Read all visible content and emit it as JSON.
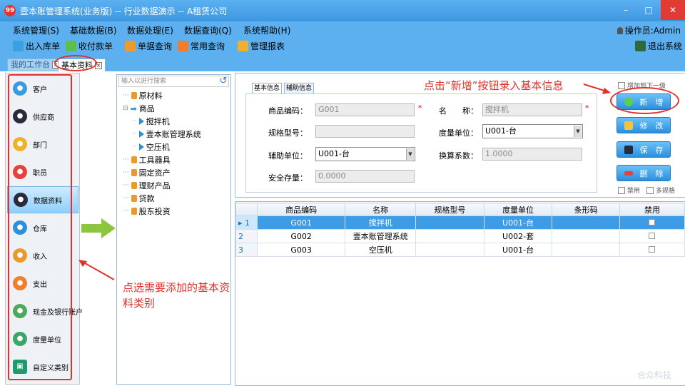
{
  "window": {
    "logo": "99",
    "title": "壹本账管理系统(业务版) -- 行业数据演示 -- A租赁公司",
    "min": "–",
    "max": "□",
    "close": "✕"
  },
  "menubar": {
    "items": [
      "系统管理(S)",
      "基础数据(B)",
      "数据处理(E)",
      "数据查询(Q)",
      "系统帮助(H)"
    ],
    "operator": "操作员:Admin"
  },
  "toolbar": {
    "items": [
      "出入库单",
      "收付款单",
      "单据查询",
      "常用查询",
      "管理报表"
    ],
    "exit": "退出系统"
  },
  "doc_tabs": {
    "workbench": "我的工作台",
    "basic": "基本资料",
    "close_glyph": "×"
  },
  "nav": {
    "items": [
      "客户",
      "供应商",
      "部门",
      "职员",
      "数据资料",
      "仓库",
      "收入",
      "支出",
      "现金及银行账户",
      "度量单位",
      "自定义类别"
    ],
    "active": "数据资料"
  },
  "tree": {
    "search_placeholder": "输入以进行搜索",
    "refresh_glyph": "↺",
    "items": [
      {
        "label": "原材料",
        "level": 0,
        "kind": "leaf"
      },
      {
        "label": "商品",
        "level": 0,
        "kind": "open"
      },
      {
        "label": "搅拌机",
        "level": 1,
        "kind": "child"
      },
      {
        "label": "壹本账管理系统",
        "level": 1,
        "kind": "child"
      },
      {
        "label": "空压机",
        "level": 1,
        "kind": "child"
      },
      {
        "label": "工具器具",
        "level": 0,
        "kind": "leaf"
      },
      {
        "label": "固定资产",
        "level": 0,
        "kind": "leaf"
      },
      {
        "label": "理财产品",
        "level": 0,
        "kind": "leaf"
      },
      {
        "label": "贷款",
        "level": 0,
        "kind": "leaf"
      },
      {
        "label": "股东投资",
        "level": 0,
        "kind": "leaf"
      }
    ]
  },
  "form": {
    "tabs": [
      "基本信息",
      "辅助信息"
    ],
    "code_label": "商品编码：",
    "code_value": "G001",
    "name_label": "名　　称：",
    "name_value": "搅拌机",
    "spec_label": "规格型号：",
    "spec_value": "",
    "unit_label": "度量单位：",
    "unit_value": "U001-台",
    "aux_unit_label": "辅助单位：",
    "aux_unit_value": "U001-台",
    "ratio_label": "换算系数：",
    "ratio_value": "1.0000",
    "safety_label": "安全存量：",
    "safety_value": "0.0000",
    "required_mark": "*"
  },
  "actions": {
    "add_child": "增加到下一级",
    "add": "新　增",
    "edit": "修　改",
    "save": "保　存",
    "delete": "删　除",
    "disabled": "禁用",
    "multi_spec": "多规格"
  },
  "grid": {
    "columns": [
      "商品编码",
      "名称",
      "规格型号",
      "度量单位",
      "条形码",
      "禁用"
    ],
    "rows": [
      {
        "idx": "1",
        "code": "G001",
        "name": "搅拌机",
        "spec": "",
        "unit": "U001-台",
        "barcode": ""
      },
      {
        "idx": "2",
        "code": "G002",
        "name": "壹本账管理系统",
        "spec": "",
        "unit": "U002-套",
        "barcode": ""
      },
      {
        "idx": "3",
        "code": "G003",
        "name": "空压机",
        "spec": "",
        "unit": "U001-台",
        "barcode": ""
      }
    ],
    "selected_row": 0
  },
  "annotations": {
    "top": "点击“新增”按钮录入基本信息",
    "left": "点选需要添加的基本资料类别"
  },
  "watermark": "合众科技",
  "colors": {
    "chrome": "#5cb0f0",
    "accent": "#2b8fdf",
    "annotation": "#e3302b",
    "selected": "#3e9be6"
  }
}
